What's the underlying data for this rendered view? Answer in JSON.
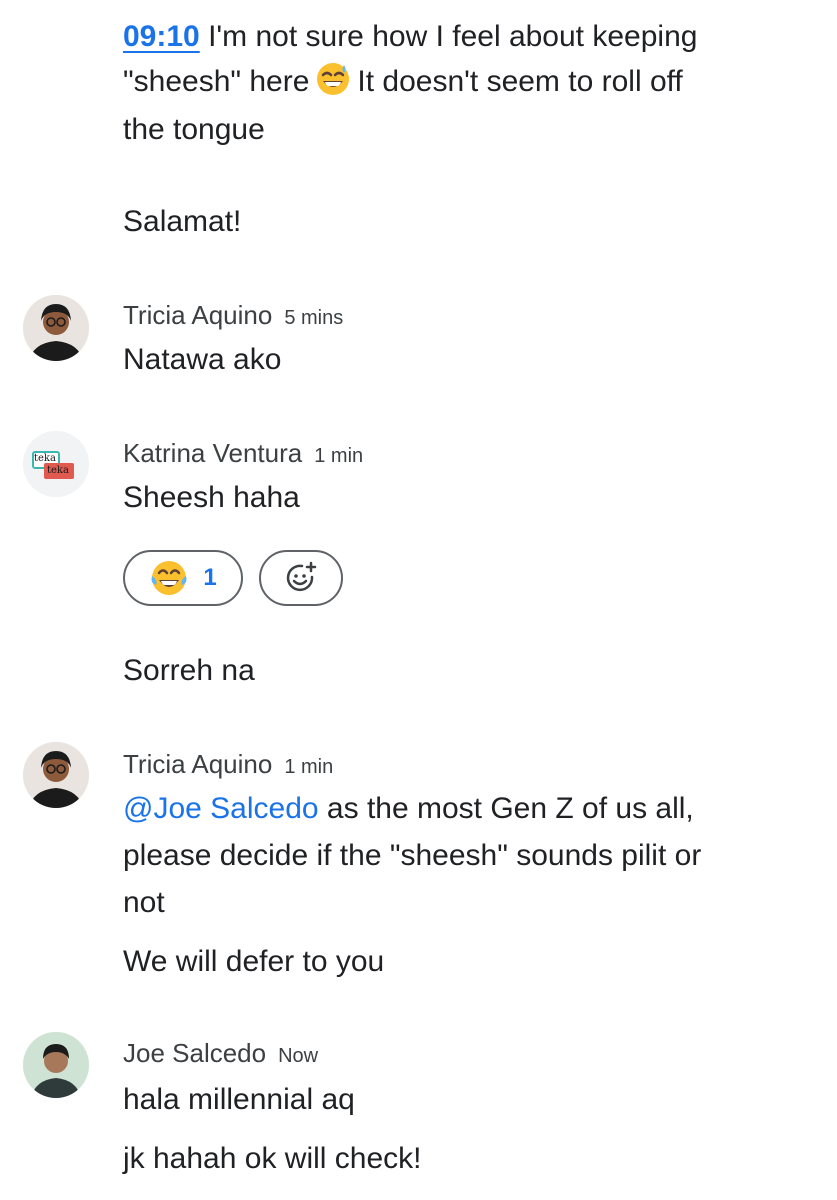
{
  "thread": {
    "first_message": {
      "timestamp_link": "09:10",
      "line1_rest": "I'm not sure how I feel about keeping",
      "line2_before_emoji": "\"sheesh\" here",
      "emoji_name": "sweat-smile-emoji",
      "line2_after_emoji": "It doesn't seem to roll off",
      "line3": "the tongue",
      "line4": "Salamat!"
    },
    "comments": [
      {
        "author": "Tricia Aquino",
        "time": "5 mins",
        "lines": [
          "Natawa ako"
        ]
      },
      {
        "author": "Katrina Ventura",
        "time": "1 min",
        "lines": [
          "Sheesh haha"
        ],
        "reaction": {
          "emoji_name": "tears-of-joy-emoji",
          "count": "1"
        },
        "add_reaction_icon": "add-reaction-icon",
        "extra_line": "Sorreh na"
      },
      {
        "author": "Tricia Aquino",
        "time": "1 min",
        "mention": "@Joe Salcedo",
        "line1_rest": "as the most Gen Z of us all,",
        "line2": "please decide if the \"sheesh\" sounds pilit or",
        "line3": "not",
        "line4": "We will defer to you"
      },
      {
        "author": "Joe Salcedo",
        "time": "Now",
        "lines": [
          "hala millennial aq",
          "jk hahah ok will check!"
        ]
      }
    ],
    "avatar_logo_text": [
      "teka",
      "teka"
    ]
  },
  "colors": {
    "link": "#1a73e8",
    "text": "#202124",
    "meta": "#3c4043",
    "chip_border": "#5f6368",
    "logo_teal": "#3bb7b1",
    "logo_red": "#e05a4f"
  }
}
